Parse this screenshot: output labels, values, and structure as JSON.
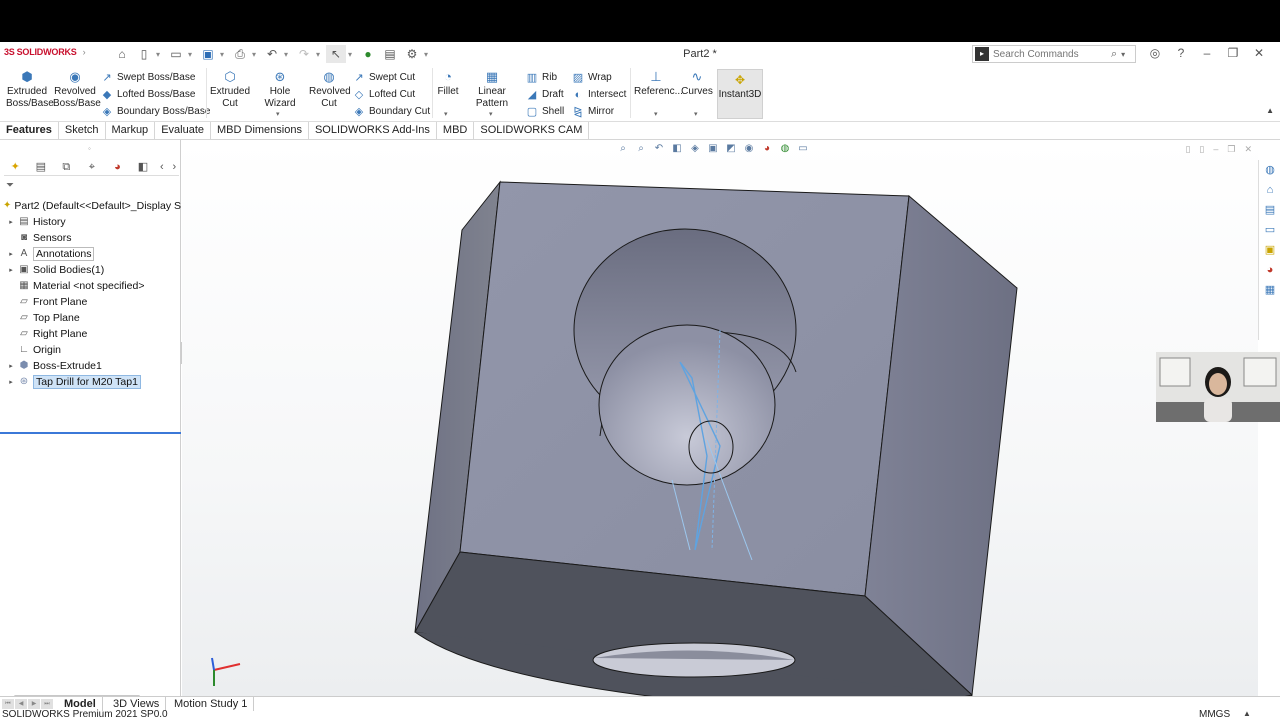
{
  "app": {
    "logo": "SOLIDWORKS",
    "document_title": "Part2 *"
  },
  "search": {
    "placeholder": "Search Commands"
  },
  "commands": {
    "extruded_boss_line1": "Extruded",
    "extruded_boss_line2": "Boss/Base",
    "revolved_boss_line1": "Revolved",
    "revolved_boss_line2": "Boss/Base",
    "swept_boss": "Swept Boss/Base",
    "lofted_boss": "Lofted Boss/Base",
    "boundary_boss": "Boundary Boss/Base",
    "extruded_cut_line1": "Extruded",
    "extruded_cut_line2": "Cut",
    "hole_wizard": "Hole Wizard",
    "revolved_cut_line1": "Revolved",
    "revolved_cut_line2": "Cut",
    "swept_cut": "Swept Cut",
    "lofted_cut": "Lofted Cut",
    "boundary_cut": "Boundary Cut",
    "fillet": "Fillet",
    "linear_pattern": "Linear Pattern",
    "rib": "Rib",
    "draft": "Draft",
    "shell": "Shell",
    "wrap": "Wrap",
    "intersect": "Intersect",
    "mirror": "Mirror",
    "reference": "Referenc...",
    "curves": "Curves",
    "instant3d": "Instant3D"
  },
  "tabs": [
    "Features",
    "Sketch",
    "Markup",
    "Evaluate",
    "MBD Dimensions",
    "SOLIDWORKS Add-Ins",
    "MBD",
    "SOLIDWORKS CAM"
  ],
  "tree": {
    "root": "Part2  (Default<<Default>_Display S",
    "items": [
      {
        "label": "History",
        "icon": "history-icon"
      },
      {
        "label": "Sensors",
        "icon": "sensors-icon"
      },
      {
        "label": "Annotations",
        "icon": "annotations-icon"
      },
      {
        "label": "Solid Bodies(1)",
        "icon": "solid-bodies-icon"
      },
      {
        "label": "Material <not specified>",
        "icon": "material-icon"
      },
      {
        "label": "Front Plane",
        "icon": "plane-icon"
      },
      {
        "label": "Top Plane",
        "icon": "plane-icon"
      },
      {
        "label": "Right Plane",
        "icon": "plane-icon"
      },
      {
        "label": "Origin",
        "icon": "origin-icon"
      },
      {
        "label": "Boss-Extrude1",
        "icon": "extrude-icon"
      },
      {
        "label": "Tap Drill for M20 Tap1",
        "icon": "hole-icon"
      }
    ]
  },
  "bottom_tabs": [
    "Model",
    "3D Views",
    "Motion Study 1"
  ],
  "status": {
    "text": "SOLIDWORKS Premium 2021 SP0.0",
    "units": "MMGS"
  },
  "colors": {
    "brand_red": "#c8102e",
    "model_face": "#8f93a6",
    "model_dark": "#50535e",
    "selection_blue": "#3b78d8"
  }
}
